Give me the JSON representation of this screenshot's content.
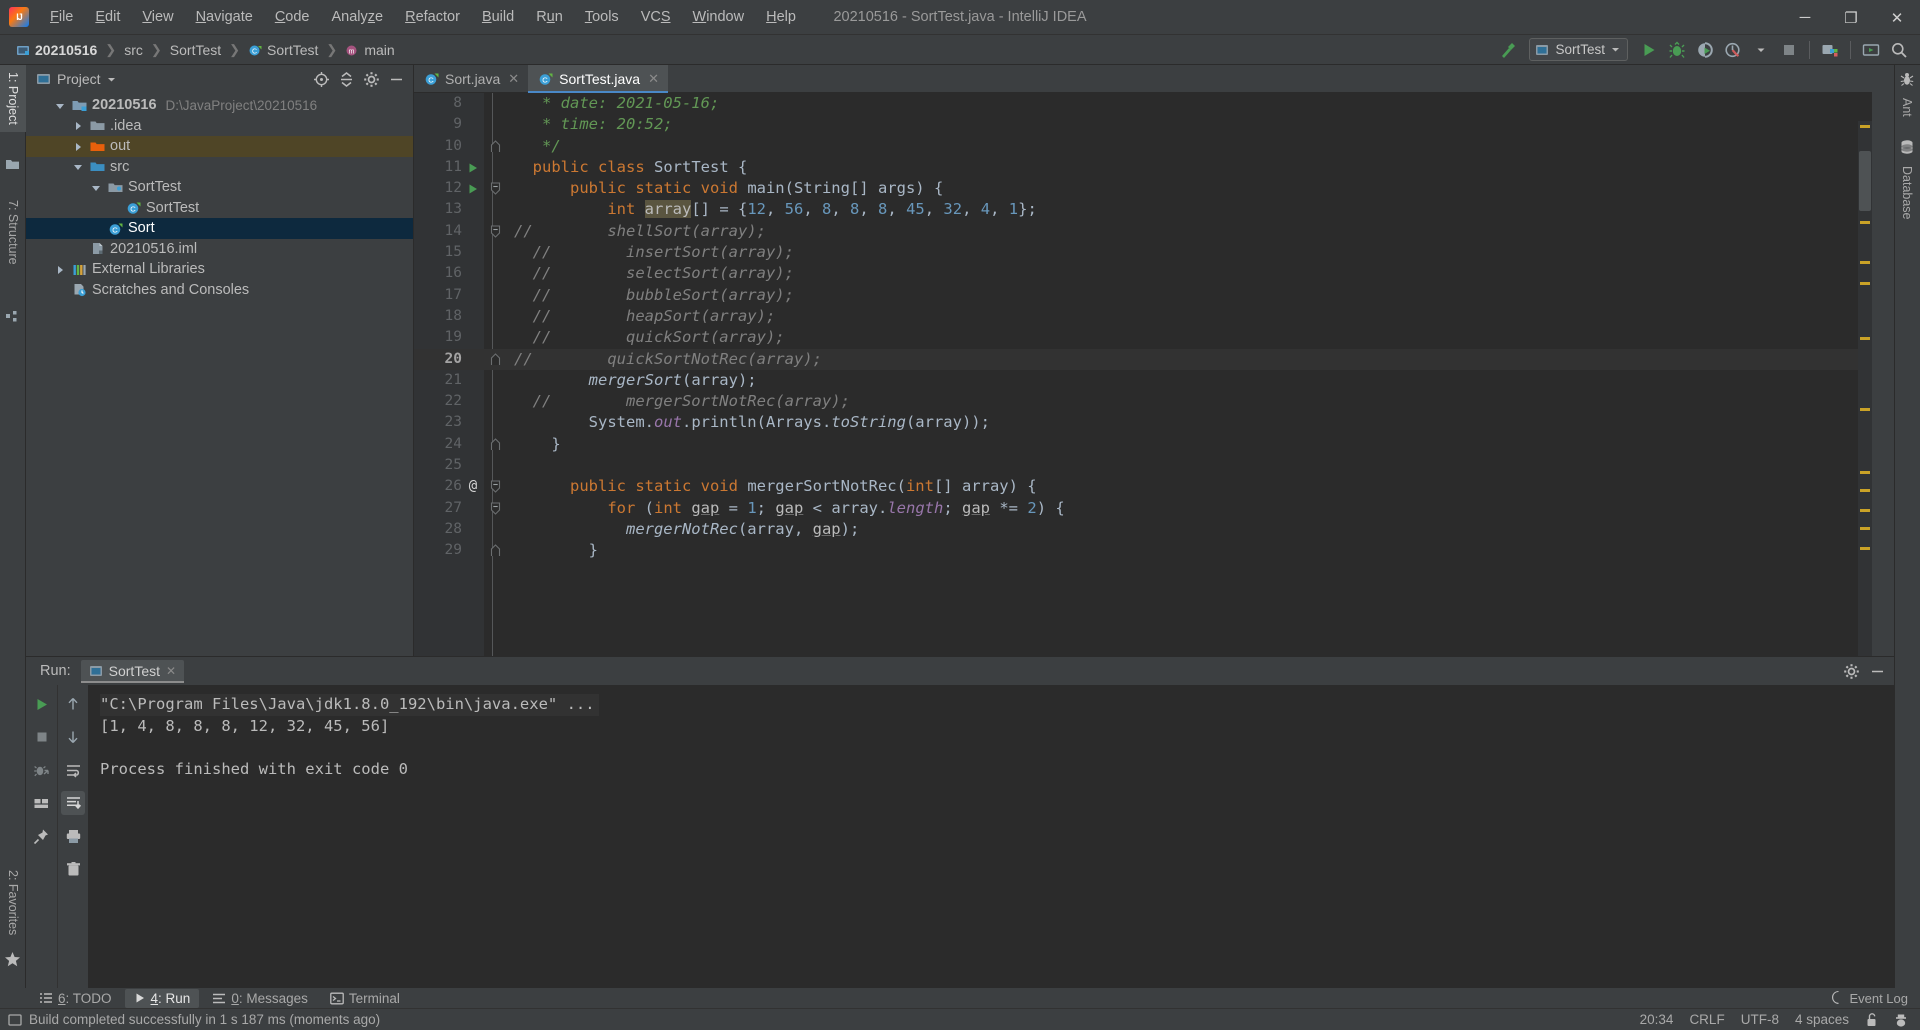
{
  "window": {
    "title": "20210516 - SortTest.java - IntelliJ IDEA",
    "minimize": "─",
    "maximize": "❐",
    "close": "✕"
  },
  "menu": {
    "items": [
      {
        "label": "File",
        "mnemonic": "F"
      },
      {
        "label": "Edit",
        "mnemonic": "E"
      },
      {
        "label": "View",
        "mnemonic": "V"
      },
      {
        "label": "Navigate",
        "mnemonic": "N"
      },
      {
        "label": "Code",
        "mnemonic": "C"
      },
      {
        "label": "Analyze",
        "mnemonic": "z"
      },
      {
        "label": "Refactor",
        "mnemonic": "R"
      },
      {
        "label": "Build",
        "mnemonic": "B"
      },
      {
        "label": "Run",
        "mnemonic": "u"
      },
      {
        "label": "Tools",
        "mnemonic": "T"
      },
      {
        "label": "VCS",
        "mnemonic": "S"
      },
      {
        "label": "Window",
        "mnemonic": "W"
      },
      {
        "label": "Help",
        "mnemonic": "H"
      }
    ]
  },
  "breadcrumbs": [
    {
      "label": "20210516",
      "icon": "project-icon",
      "bold": true
    },
    {
      "label": "src",
      "icon": "folder-icon",
      "bold": false
    },
    {
      "label": "SortTest",
      "icon": "package-icon",
      "bold": false
    },
    {
      "label": "SortTest",
      "icon": "java-class-icon",
      "bold": false
    },
    {
      "label": "main",
      "icon": "method-icon",
      "bold": false
    }
  ],
  "toolbar": {
    "build_label": "Build Project",
    "run_config": "SortTest",
    "run_label": "Run",
    "debug_label": "Debug",
    "run_coverage_label": "Run with Coverage",
    "profiler_label": "Profiler",
    "stop_label": "Stop",
    "updates_label": "Update Project",
    "present_label": "Presentation Mode",
    "search_label": "Search Everywhere"
  },
  "left_stripe": {
    "tabs": [
      {
        "label": "1: Project",
        "mnemonic": "1",
        "icon": "folder-icon",
        "active": true
      },
      {
        "label": "7: Structure",
        "mnemonic": "7",
        "icon": "structure-icon",
        "active": false
      },
      {
        "label": "2: Favorites",
        "mnemonic": "2",
        "icon": "star-icon",
        "active": false
      }
    ]
  },
  "right_stripe": {
    "tabs": [
      {
        "label": "Ant",
        "icon": "ant-icon"
      },
      {
        "label": "Database",
        "icon": "database-icon"
      }
    ]
  },
  "project_panel": {
    "title": "Project",
    "locate_label": "Select Opened File",
    "collapse_label": "Collapse All",
    "settings_label": "Settings",
    "hide_label": "Hide",
    "tree": [
      {
        "label": "20210516",
        "path": "D:\\JavaProject\\20210516",
        "indent": 0,
        "arrow": "expanded",
        "icon": "project-root-icon",
        "bold": true,
        "state": "none"
      },
      {
        "label": ".idea",
        "path": "",
        "indent": 1,
        "arrow": "collapsed",
        "icon": "folder-icon",
        "bold": false,
        "state": "none"
      },
      {
        "label": "out",
        "path": "",
        "indent": 1,
        "arrow": "collapsed",
        "icon": "folder-excluded-icon",
        "bold": false,
        "state": "highlight"
      },
      {
        "label": "src",
        "path": "",
        "indent": 1,
        "arrow": "expanded",
        "icon": "folder-source-icon",
        "bold": false,
        "state": "none"
      },
      {
        "label": "SortTest",
        "path": "",
        "indent": 2,
        "arrow": "expanded",
        "icon": "package-icon",
        "bold": false,
        "state": "none"
      },
      {
        "label": "SortTest",
        "path": "",
        "indent": 3,
        "arrow": "none",
        "icon": "java-class-icon",
        "bold": false,
        "state": "none"
      },
      {
        "label": "Sort",
        "path": "",
        "indent": 2,
        "arrow": "none",
        "icon": "java-class-icon",
        "bold": false,
        "state": "selected"
      },
      {
        "label": "20210516.iml",
        "path": "",
        "indent": 2,
        "arrow": "none",
        "icon": "iml-file-icon",
        "bold": false,
        "state": "none"
      },
      {
        "label": "External Libraries",
        "path": "",
        "indent": 0,
        "arrow": "collapsed",
        "icon": "libraries-icon",
        "bold": false,
        "state": "none"
      },
      {
        "label": "Scratches and Consoles",
        "path": "",
        "indent": 0,
        "arrow": "none",
        "icon": "scratches-icon",
        "bold": false,
        "state": "none"
      }
    ]
  },
  "editor": {
    "tabs": [
      {
        "label": "Sort.java",
        "icon": "java-class-icon",
        "active": false
      },
      {
        "label": "SortTest.java",
        "icon": "java-class-icon",
        "active": true
      }
    ],
    "close_glyph": "✕",
    "first_line": 8,
    "current_line": 20,
    "lines": [
      {
        "n": 8,
        "gutter": "",
        "fold": "",
        "current": false,
        "tokens": [
          {
            "t": "   * date: 2021-05-16;",
            "c": "jdoc"
          }
        ]
      },
      {
        "n": 9,
        "gutter": "",
        "fold": "",
        "current": false,
        "tokens": [
          {
            "t": "   * time: 20:52;",
            "c": "jdoc"
          }
        ]
      },
      {
        "n": 10,
        "gutter": "",
        "fold": "end",
        "current": false,
        "tokens": [
          {
            "t": "   */",
            "c": "jdoc"
          }
        ]
      },
      {
        "n": 11,
        "gutter": "run",
        "fold": "",
        "current": false,
        "tokens": [
          {
            "t": "  ",
            "c": "pln"
          },
          {
            "t": "public class ",
            "c": "kw"
          },
          {
            "t": "SortTest {",
            "c": "cls"
          }
        ]
      },
      {
        "n": 12,
        "gutter": "run",
        "fold": "start",
        "current": false,
        "tokens": [
          {
            "t": "      ",
            "c": "pln"
          },
          {
            "t": "public static void ",
            "c": "kw"
          },
          {
            "t": "main",
            "c": "mainm"
          },
          {
            "t": "(String[] args) {",
            "c": "pln"
          }
        ]
      },
      {
        "n": 13,
        "gutter": "",
        "fold": "",
        "current": false,
        "tokens": [
          {
            "t": "          ",
            "c": "pln"
          },
          {
            "t": "int ",
            "c": "kw"
          },
          {
            "t": "array",
            "c": "identhl"
          },
          {
            "t": "[] = {",
            "c": "pln"
          },
          {
            "t": "12",
            "c": "num"
          },
          {
            "t": ", ",
            "c": "pln"
          },
          {
            "t": "56",
            "c": "num"
          },
          {
            "t": ", ",
            "c": "pln"
          },
          {
            "t": "8",
            "c": "num"
          },
          {
            "t": ", ",
            "c": "pln"
          },
          {
            "t": "8",
            "c": "num"
          },
          {
            "t": ", ",
            "c": "pln"
          },
          {
            "t": "8",
            "c": "num"
          },
          {
            "t": ", ",
            "c": "pln"
          },
          {
            "t": "45",
            "c": "num"
          },
          {
            "t": ", ",
            "c": "pln"
          },
          {
            "t": "32",
            "c": "num"
          },
          {
            "t": ", ",
            "c": "pln"
          },
          {
            "t": "4",
            "c": "num"
          },
          {
            "t": ", ",
            "c": "pln"
          },
          {
            "t": "1",
            "c": "num"
          },
          {
            "t": "};",
            "c": "pln"
          }
        ]
      },
      {
        "n": 14,
        "gutter": "",
        "fold": "start",
        "current": false,
        "tokens": [
          {
            "t": "//        shellSort(array);",
            "c": "cmt"
          }
        ]
      },
      {
        "n": 15,
        "gutter": "",
        "fold": "",
        "current": false,
        "tokens": [
          {
            "t": "  //        insertSort(array);",
            "c": "cmt"
          }
        ]
      },
      {
        "n": 16,
        "gutter": "",
        "fold": "",
        "current": false,
        "tokens": [
          {
            "t": "  //        selectSort(array);",
            "c": "cmt"
          }
        ]
      },
      {
        "n": 17,
        "gutter": "",
        "fold": "",
        "current": false,
        "tokens": [
          {
            "t": "  //        bubbleSort(array);",
            "c": "cmt"
          }
        ]
      },
      {
        "n": 18,
        "gutter": "",
        "fold": "",
        "current": false,
        "tokens": [
          {
            "t": "  //        heapSort(array);",
            "c": "cmt"
          }
        ]
      },
      {
        "n": 19,
        "gutter": "",
        "fold": "",
        "current": false,
        "tokens": [
          {
            "t": "  //        quickSort(array);",
            "c": "cmt"
          }
        ]
      },
      {
        "n": 20,
        "gutter": "",
        "fold": "end",
        "current": true,
        "tokens": [
          {
            "t": "//        quickSortNotRec(array);",
            "c": "cmt"
          }
        ]
      },
      {
        "n": 21,
        "gutter": "",
        "fold": "",
        "current": false,
        "tokens": [
          {
            "t": "        ",
            "c": "pln"
          },
          {
            "t": "mergerSort",
            "c": "stm"
          },
          {
            "t": "(array);",
            "c": "pln"
          }
        ]
      },
      {
        "n": 22,
        "gutter": "",
        "fold": "",
        "current": false,
        "tokens": [
          {
            "t": "  //        mergerSortNotRec(array);",
            "c": "cmt"
          }
        ]
      },
      {
        "n": 23,
        "gutter": "",
        "fold": "",
        "current": false,
        "tokens": [
          {
            "t": "        System.",
            "c": "pln"
          },
          {
            "t": "out",
            "c": "fld"
          },
          {
            "t": ".println(Arrays.",
            "c": "pln"
          },
          {
            "t": "toString",
            "c": "stm"
          },
          {
            "t": "(array));",
            "c": "pln"
          }
        ]
      },
      {
        "n": 24,
        "gutter": "",
        "fold": "end",
        "current": false,
        "tokens": [
          {
            "t": "    }",
            "c": "pln"
          }
        ]
      },
      {
        "n": 25,
        "gutter": "",
        "fold": "",
        "current": false,
        "tokens": [
          {
            "t": "",
            "c": "pln"
          }
        ]
      },
      {
        "n": 26,
        "gutter": "at",
        "fold": "start",
        "current": false,
        "tokens": [
          {
            "t": "      ",
            "c": "pln"
          },
          {
            "t": "public static void ",
            "c": "kw"
          },
          {
            "t": "mergerSortNotRec",
            "c": "cls"
          },
          {
            "t": "(",
            "c": "pln"
          },
          {
            "t": "int",
            "c": "kw"
          },
          {
            "t": "[] array) {",
            "c": "pln"
          }
        ]
      },
      {
        "n": 27,
        "gutter": "",
        "fold": "start",
        "current": false,
        "tokens": [
          {
            "t": "          ",
            "c": "pln"
          },
          {
            "t": "for ",
            "c": "kw"
          },
          {
            "t": "(",
            "c": "pln"
          },
          {
            "t": "int ",
            "c": "kw"
          },
          {
            "t": "gap",
            "c": "und"
          },
          {
            "t": " = ",
            "c": "pln"
          },
          {
            "t": "1",
            "c": "num"
          },
          {
            "t": "; ",
            "c": "pln"
          },
          {
            "t": "gap",
            "c": "und"
          },
          {
            "t": " < array.",
            "c": "pln"
          },
          {
            "t": "length",
            "c": "fld"
          },
          {
            "t": "; ",
            "c": "pln"
          },
          {
            "t": "gap",
            "c": "und"
          },
          {
            "t": " *= ",
            "c": "pln"
          },
          {
            "t": "2",
            "c": "num"
          },
          {
            "t": ") {",
            "c": "pln"
          }
        ]
      },
      {
        "n": 28,
        "gutter": "",
        "fold": "",
        "current": false,
        "tokens": [
          {
            "t": "            ",
            "c": "pln"
          },
          {
            "t": "mergerNotRec",
            "c": "stm"
          },
          {
            "t": "(array, ",
            "c": "pln"
          },
          {
            "t": "gap",
            "c": "und"
          },
          {
            "t": ");",
            "c": "pln"
          }
        ]
      },
      {
        "n": 29,
        "gutter": "",
        "fold": "end",
        "current": false,
        "tokens": [
          {
            "t": "        }",
            "c": "pln"
          }
        ]
      }
    ],
    "markers_color": "#c9a227"
  },
  "run_panel": {
    "label": "Run:",
    "tab_label": "SortTest",
    "tab_icon": "run-config-icon",
    "close_glyph": "✕",
    "settings_label": "Settings",
    "hide_label": "Hide",
    "tools": {
      "rerun": "Rerun",
      "stop": "Stop",
      "restart_failed": "Rerun Failed Tests",
      "layout": "Layout Settings",
      "pin": "Pin Tab",
      "up": "Up the Stack Trace",
      "down": "Down the Stack Trace",
      "softwrap": "Soft-Wrap",
      "scroll_to_end": "Scroll to End",
      "print": "Print",
      "clear": "Clear All"
    },
    "console": [
      {
        "text": "\"C:\\Program Files\\Java\\jdk1.8.0_192\\bin\\java.exe\" ...",
        "style": "cmd"
      },
      {
        "text": "[1, 4, 8, 8, 8, 12, 32, 45, 56]",
        "style": "out"
      },
      {
        "text": "",
        "style": "blank"
      },
      {
        "text": "Process finished with exit code 0",
        "style": "out"
      }
    ]
  },
  "bottom_stripe": {
    "tabs": [
      {
        "label": "6: TODO",
        "mnemonic": "6",
        "icon": "todo-icon",
        "active": false
      },
      {
        "label": "4: Run",
        "mnemonic": "4",
        "icon": "run-icon",
        "active": true
      },
      {
        "label": "0: Messages",
        "mnemonic": "0",
        "icon": "messages-icon",
        "active": false
      },
      {
        "label": "Terminal",
        "mnemonic": "",
        "icon": "terminal-icon",
        "active": false
      }
    ],
    "event_log": "Event Log"
  },
  "statusbar": {
    "message": "Build completed successfully in 1 s 187 ms (moments ago)",
    "time": "20:34",
    "line_separator": "CRLF",
    "encoding": "UTF-8",
    "indent": "4 spaces",
    "lock_label": "Toggle read-only attribute",
    "inspection_label": "Highlighting level"
  },
  "colors": {
    "accent_blue": "#4a88c7",
    "selection_blue": "#0d293e",
    "warn_yellow": "#c9a227",
    "run_green": "#499c54",
    "excluded_orange": "#cc7832"
  }
}
